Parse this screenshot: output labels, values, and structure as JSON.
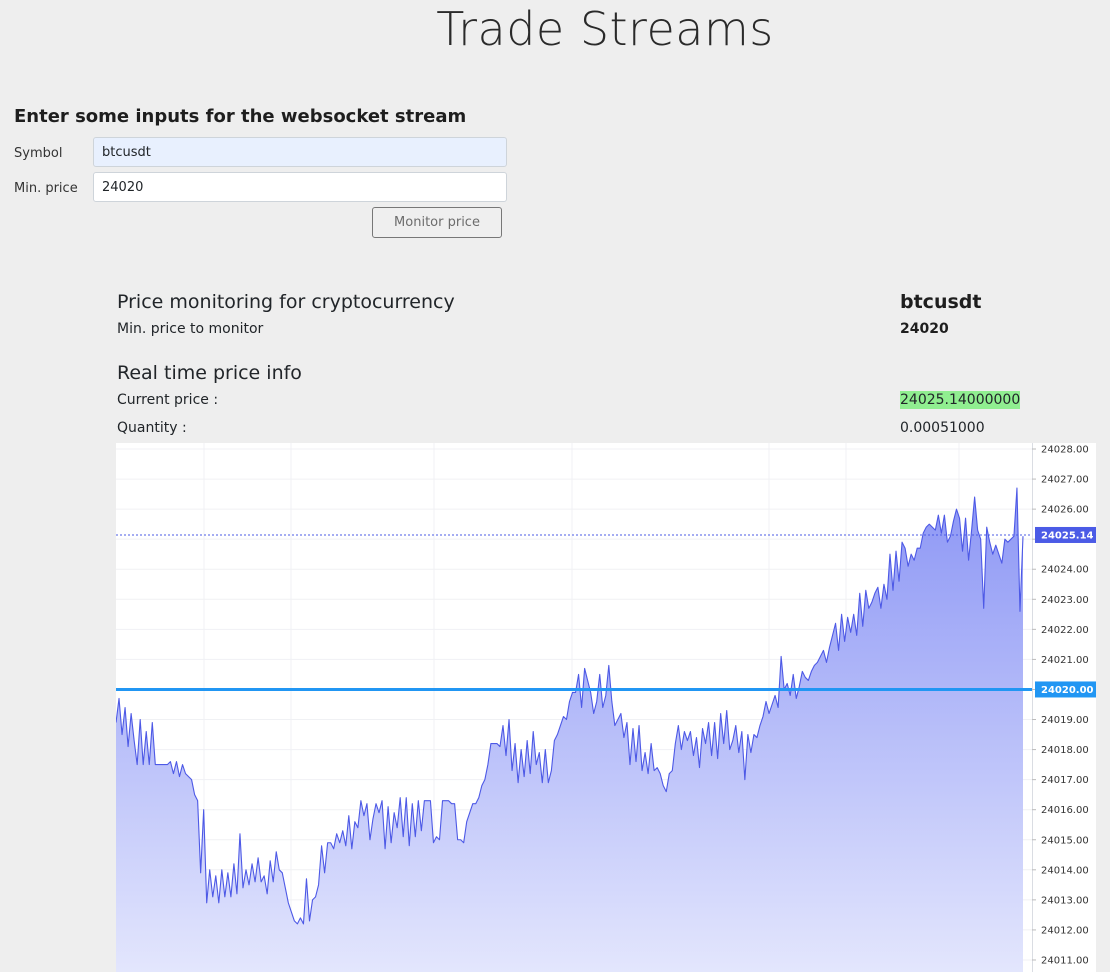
{
  "page": {
    "title": "Trade Streams"
  },
  "form": {
    "heading": "Enter some inputs for the websocket stream",
    "symbol_label": "Symbol",
    "symbol_value": "btcusdt",
    "min_price_label": "Min. price",
    "min_price_value": "24020",
    "submit_label": "Monitor price"
  },
  "monitor": {
    "heading": "Price monitoring for cryptocurrency",
    "symbol": "btcusdt",
    "min_price_label": "Min. price to monitor",
    "min_price": "24020",
    "realtime_heading": "Real time price info",
    "current_price_label": "Current price :",
    "current_price": "24025.14000000",
    "quantity_label": "Quantity :",
    "quantity": "0.00051000"
  },
  "colors": {
    "series_line": "#4d59e6",
    "area_top": "#8c96f5",
    "area_bottom": "#e3e6fd",
    "last_price_badge": "#4b5be6",
    "min_price_line": "#2196f3",
    "current_price_highlight": "#90ee90"
  },
  "chart_data": {
    "type": "area",
    "ylim": [
      24010.6,
      24028.2
    ],
    "yticks": [
      "24028.00",
      "24027.00",
      "24026.00",
      "24025.00",
      "24024.00",
      "24023.00",
      "24022.00",
      "24021.00",
      "24020.00",
      "24019.00",
      "24018.00",
      "24017.00",
      "24016.00",
      "24015.00",
      "24014.00",
      "24013.00",
      "24012.00",
      "24011.00"
    ],
    "last_price": 24025.14,
    "last_price_label": "24025.14",
    "min_price_line": 24020.0,
    "min_price_label": "24020.00",
    "series": [
      {
        "values": [
          24018.9,
          24019.7,
          24018.5,
          24019.4,
          24018.1,
          24019.2,
          24018.3,
          24017.5,
          24019.0,
          24017.5,
          24018.6,
          24017.5,
          24018.9,
          24017.5,
          24017.5,
          24017.5,
          24017.5,
          24017.5,
          24017.6,
          24017.2,
          24017.6,
          24017.1,
          24017.5,
          24017.2,
          24017.1,
          24017.0,
          24016.5,
          24016.3,
          24013.9,
          24016.0,
          24012.9,
          24014.0,
          24013.1,
          24013.8,
          24012.9,
          24014.0,
          24013.1,
          24013.9,
          24013.1,
          24014.2,
          24013.2,
          24015.2,
          24013.4,
          24014.0,
          24013.5,
          24014.2,
          24013.6,
          24014.4,
          24013.6,
          24013.8,
          24013.2,
          24014.3,
          24013.6,
          24014.6,
          24014.0,
          24013.9,
          24013.4,
          24012.9,
          24012.6,
          24012.3,
          24012.2,
          24012.4,
          24012.2,
          24013.7,
          24012.3,
          24013.0,
          24013.1,
          24013.5,
          24014.8,
          24013.9,
          24014.9,
          24014.9,
          24014.7,
          24015.2,
          24014.9,
          24015.3,
          24014.8,
          24015.8,
          24014.7,
          24015.6,
          24015.4,
          24016.3,
          24015.8,
          24016.2,
          24015.0,
          24015.7,
          24016.2,
          24015.9,
          24016.3,
          24014.7,
          24016.1,
          24014.9,
          24015.9,
          24015.4,
          24016.4,
          24015.1,
          24016.4,
          24014.8,
          24016.2,
          24015.1,
          24016.3,
          24015.3,
          24016.3,
          24016.3,
          24016.3,
          24014.9,
          24015.1,
          24015.0,
          24016.3,
          24016.3,
          24016.3,
          24016.2,
          24016.2,
          24015.0,
          24015.0,
          24014.9,
          24015.6,
          24015.9,
          24016.2,
          24016.2,
          24016.4,
          24016.8,
          24017.0,
          24017.5,
          24018.2,
          24018.2,
          24018.2,
          24018.1,
          24018.8,
          24017.8,
          24019.0,
          24017.3,
          24018.2,
          24016.9,
          24018.0,
          24017.1,
          24018.3,
          24017.2,
          24018.6,
          24017.5,
          24017.9,
          24016.9,
          24018.0,
          24016.9,
          24017.3,
          24018.3,
          24018.5,
          24018.8,
          24019.1,
          24019.0,
          24019.6,
          24019.9,
          24019.9,
          24020.5,
          24019.4,
          24020.7,
          24020.3,
          24019.9,
          24019.2,
          24019.6,
          24020.5,
          24019.4,
          24019.8,
          24020.8,
          24019.6,
          24018.8,
          24019.0,
          24019.2,
          24018.4,
          24018.9,
          24017.5,
          24018.7,
          24017.6,
          24018.8,
          24017.3,
          24017.9,
          24017.2,
          24018.2,
          24017.3,
          24017.4,
          24017.2,
          24016.8,
          24016.6,
          24017.2,
          24017.3,
          24018.2,
          24018.8,
          24018.0,
          24018.6,
          24018.3,
          24018.6,
          24017.8,
          24018.4,
          24017.4,
          24018.7,
          24018.2,
          24018.9,
          24017.8,
          24018.9,
          24017.7,
          24019.2,
          24018.2,
          24019.3,
          24018.0,
          24018.3,
          24018.8,
          24017.9,
          24018.6,
          24017.0,
          24018.5,
          24017.9,
          24018.5,
          24018.4,
          24018.8,
          24019.1,
          24019.6,
          24019.2,
          24019.5,
          24019.8,
          24019.4,
          24021.1,
          24020.0,
          24020.2,
          24019.8,
          24020.5,
          24019.7,
          24020.1,
          24020.6,
          24020.4,
          24020.3,
          24020.6,
          24020.8,
          24020.9,
          24021.1,
          24021.3,
          24020.9,
          24021.4,
          24021.8,
          24022.2,
          24021.3,
          24022.5,
          24021.6,
          24022.4,
          24021.9,
          24022.5,
          24021.8,
          24023.2,
          24022.1,
          24023.3,
          24022.7,
          24022.9,
          24023.2,
          24023.4,
          24022.7,
          24023.5,
          24023.0,
          24024.5,
          24023.3,
          24024.6,
          24023.6,
          24024.9,
          24024.7,
          24024.1,
          24024.5,
          24024.3,
          24024.7,
          24024.7,
          24025.2,
          24025.4,
          24025.5,
          24025.4,
          24025.3,
          24025.8,
          24025.2,
          24025.8,
          24024.9,
          24025.1,
          24025.6,
          24026.0,
          24025.7,
          24024.6,
          24025.7,
          24024.3,
          24025.3,
          24026.4,
          24025.3,
          24025.0,
          24022.7,
          24025.4,
          24024.9,
          24024.5,
          24024.8,
          24024.5,
          24024.2,
          24025.0,
          24024.9,
          24025.0,
          24025.1,
          24026.7,
          24022.6,
          24025.1
        ]
      }
    ]
  }
}
